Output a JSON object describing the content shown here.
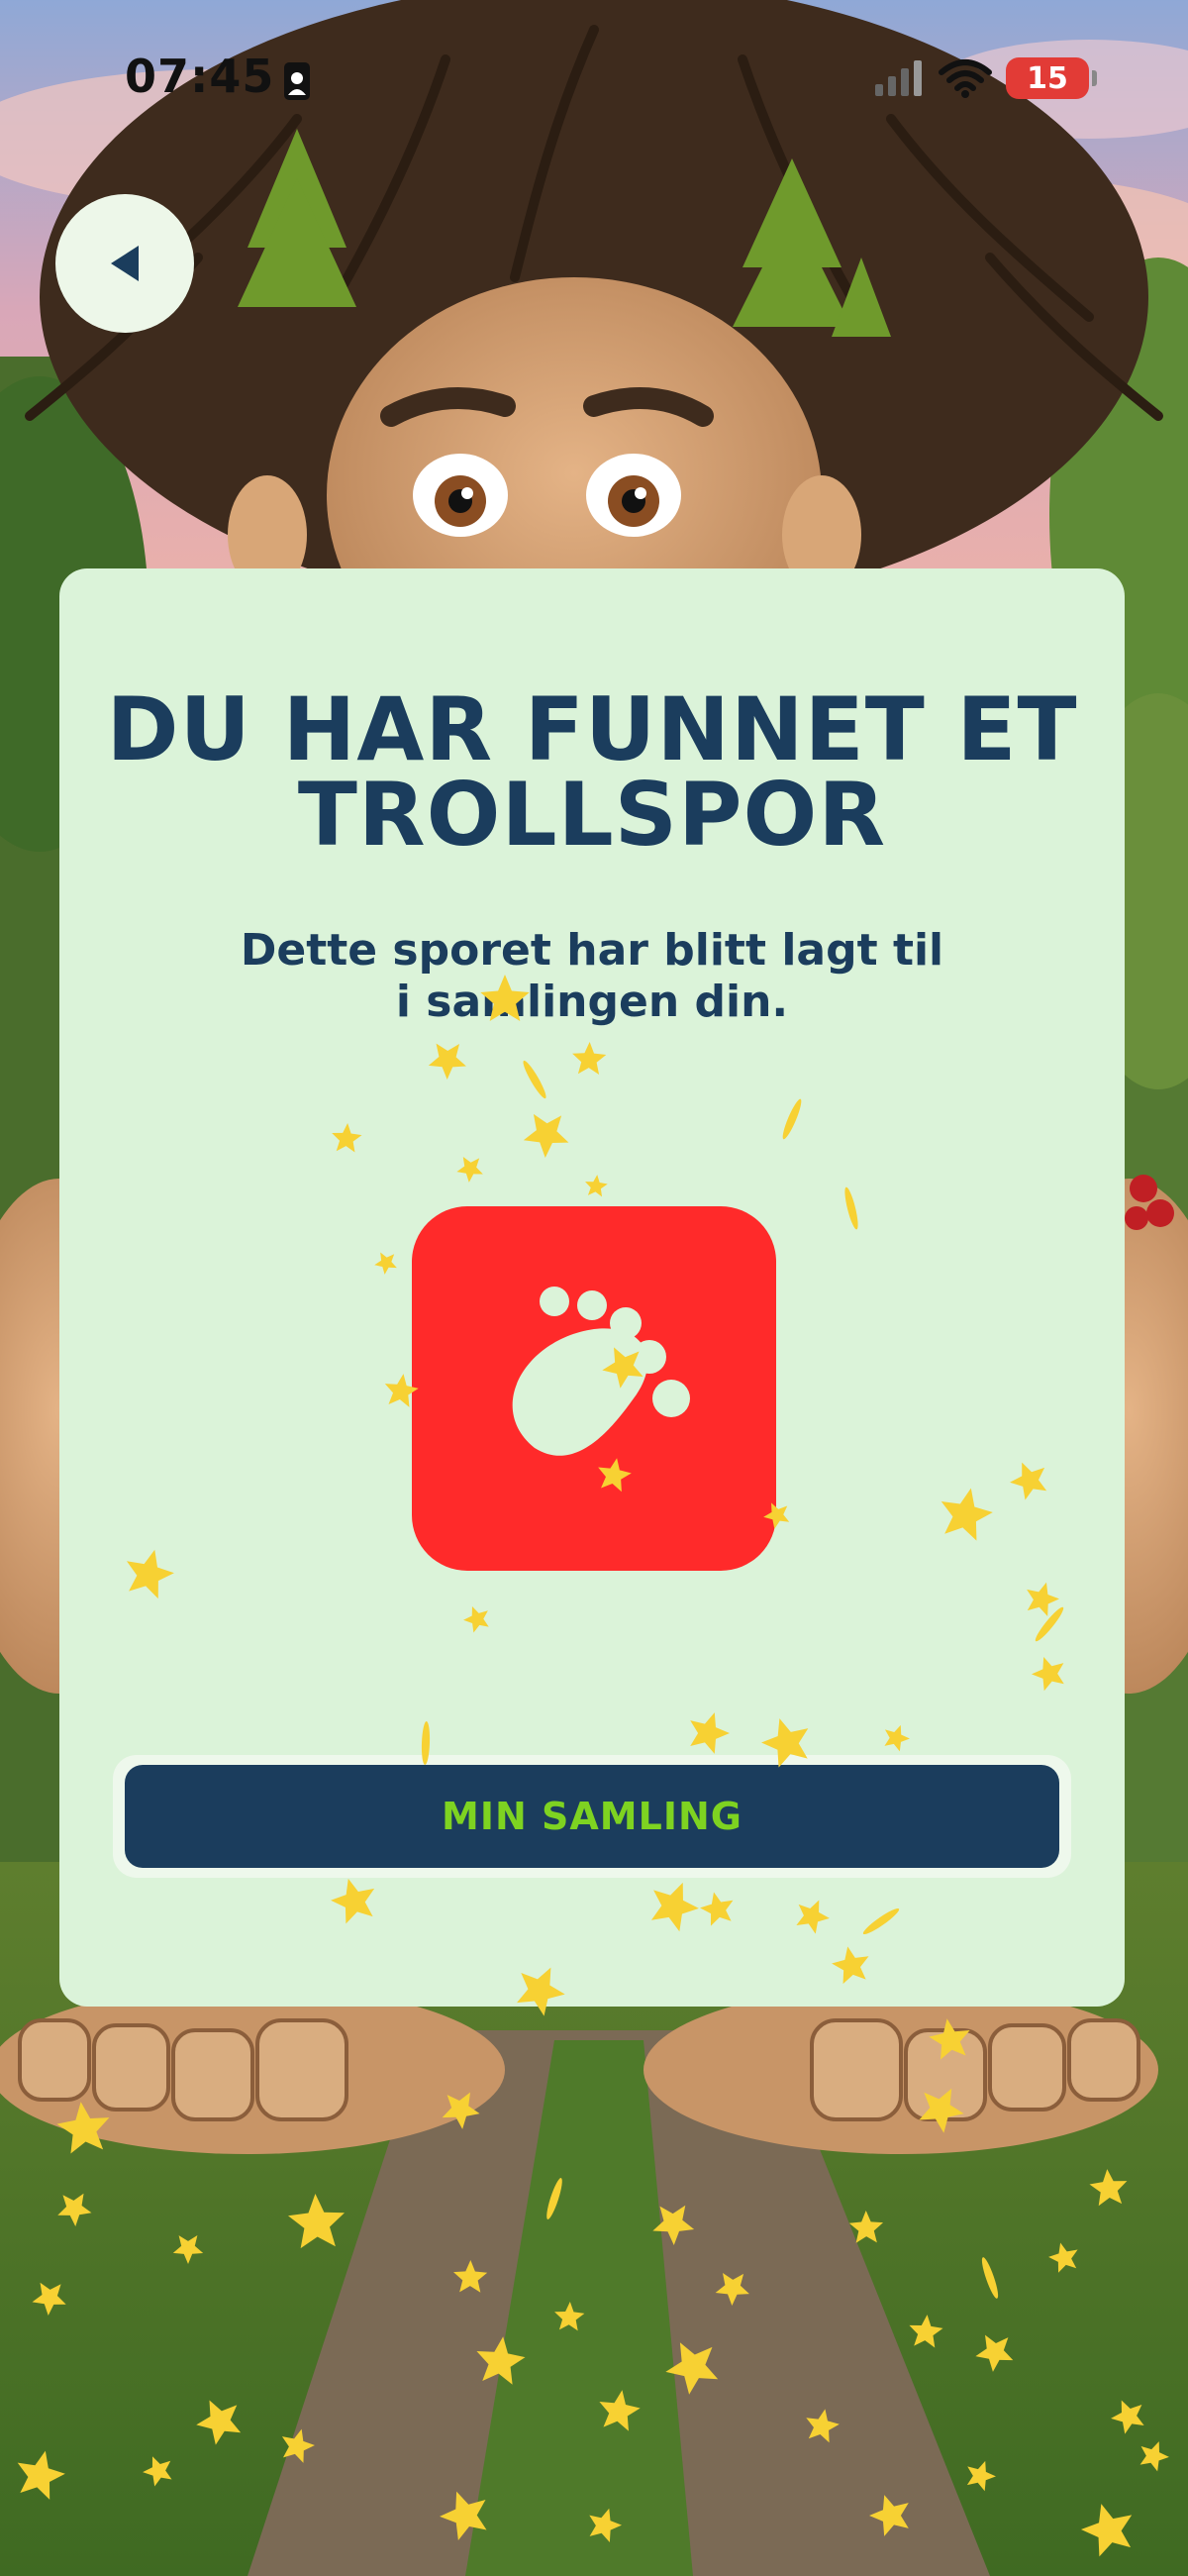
{
  "status_bar": {
    "time": "07:45",
    "battery": "15",
    "battery_color": "#e23b36"
  },
  "nav": {
    "back_icon": "back-arrow-icon"
  },
  "card": {
    "title": "DU HAR FUNNET ET TROLLSPOR",
    "subtitle": "Dette sporet har blitt lagt til i samlingen din.",
    "badge_icon": "footprint-icon",
    "badge_color": "#ff2a2a",
    "background": "#dbf3d9",
    "button_label": "MIN SAMLING",
    "button_color": "#1b3d5d",
    "button_text_color": "#7ed321"
  },
  "theme": {
    "text_color": "#1b3d5d",
    "star_color": "#f7d133"
  }
}
